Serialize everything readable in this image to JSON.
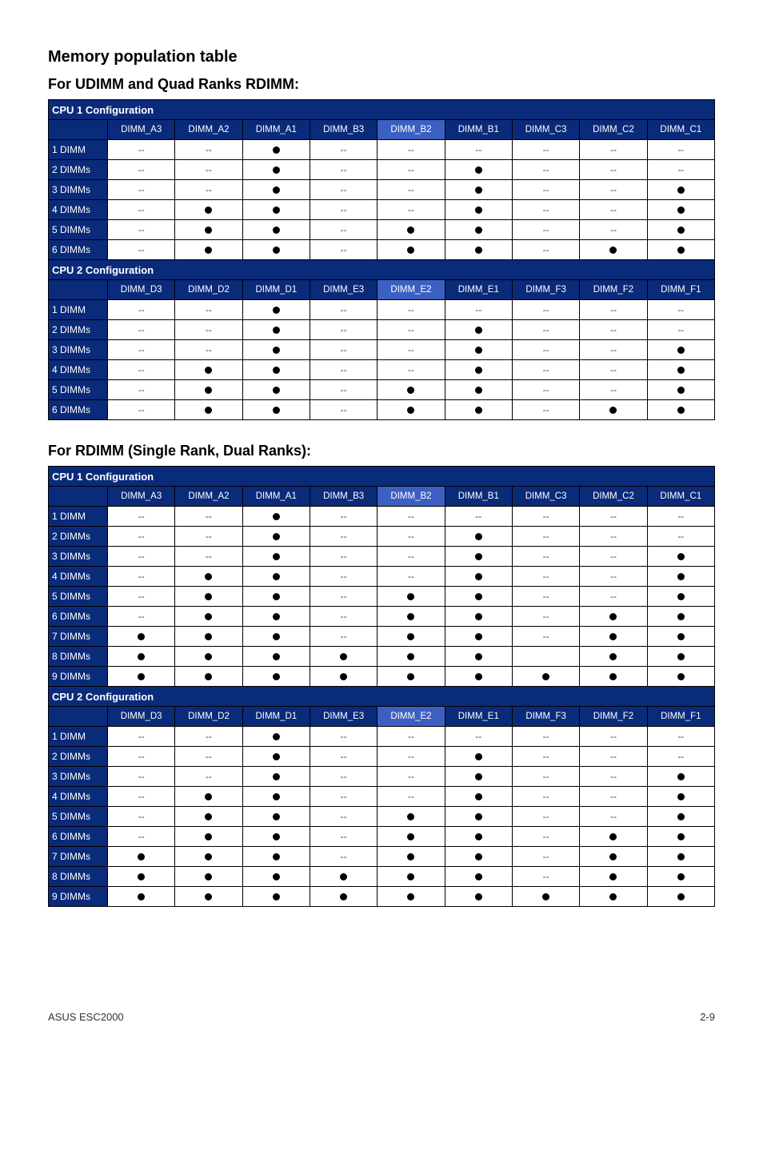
{
  "title": "Memory population table",
  "subtitle1": "For UDIMM and Quad Ranks RDIMM:",
  "subtitle2": "For RDIMM (Single Rank, Dual Ranks):",
  "footer_left": "ASUS ESC2000",
  "footer_right": "2-9",
  "cpu1_title": "CPU 1 Configuration",
  "cpu2_title": "CPU 2 Configuration",
  "cols_cpu1": [
    "DIMM_A3",
    "DIMM_A2",
    "DIMM_A1",
    "DIMM_B3",
    "DIMM_B2",
    "DIMM_B1",
    "DIMM_C3",
    "DIMM_C2",
    "DIMM_C1"
  ],
  "cols_cpu2": [
    "DIMM_D3",
    "DIMM_D2",
    "DIMM_D1",
    "DIMM_E3",
    "DIMM_E2",
    "DIMM_E1",
    "DIMM_F3",
    "DIMM_F2",
    "DIMM_F1"
  ],
  "table1": {
    "cpu1": [
      {
        "label": "1 DIMM",
        "cells": [
          "-",
          "-",
          "o",
          "-",
          "-",
          "-",
          "-",
          "-",
          "-"
        ]
      },
      {
        "label": "2 DIMMs",
        "cells": [
          "-",
          "-",
          "o",
          "-",
          "-",
          "o",
          "-",
          "-",
          "-"
        ]
      },
      {
        "label": "3 DIMMs",
        "cells": [
          "-",
          "-",
          "o",
          "-",
          "-",
          "o",
          "-",
          "-",
          "o"
        ]
      },
      {
        "label": "4 DIMMs",
        "cells": [
          "-",
          "o",
          "o",
          "-",
          "-",
          "o",
          "-",
          "-",
          "o"
        ]
      },
      {
        "label": "5 DIMMs",
        "cells": [
          "-",
          "o",
          "o",
          "-",
          "o",
          "o",
          "-",
          "-",
          "o"
        ]
      },
      {
        "label": "6 DIMMs",
        "cells": [
          "-",
          "o",
          "o",
          "-",
          "o",
          "o",
          "-",
          "o",
          "o"
        ]
      }
    ],
    "cpu2": [
      {
        "label": "1 DIMM",
        "cells": [
          "-",
          "-",
          "o",
          "-",
          "-",
          "-",
          "-",
          "-",
          "-"
        ]
      },
      {
        "label": "2 DIMMs",
        "cells": [
          "-",
          "-",
          "o",
          "-",
          "-",
          "o",
          "-",
          "-",
          "-"
        ]
      },
      {
        "label": "3 DIMMs",
        "cells": [
          "-",
          "-",
          "o",
          "-",
          "-",
          "o",
          "-",
          "-",
          "o"
        ]
      },
      {
        "label": "4 DIMMs",
        "cells": [
          "-",
          "o",
          "o",
          "-",
          "-",
          "o",
          "-",
          "-",
          "o"
        ]
      },
      {
        "label": "5 DIMMs",
        "cells": [
          "-",
          "o",
          "o",
          "-",
          "o",
          "o",
          "-",
          "-",
          "o"
        ]
      },
      {
        "label": "6 DIMMs",
        "cells": [
          "-",
          "o",
          "o",
          "-",
          "o",
          "o",
          "-",
          "o",
          "o"
        ]
      }
    ]
  },
  "table2": {
    "cpu1": [
      {
        "label": "1 DIMM",
        "cells": [
          "-",
          "-",
          "o",
          "-",
          "-",
          "-",
          "-",
          "-",
          "-"
        ]
      },
      {
        "label": "2 DIMMs",
        "cells": [
          "-",
          "-",
          "o",
          "-",
          "-",
          "o",
          "-",
          "-",
          "-"
        ]
      },
      {
        "label": "3 DIMMs",
        "cells": [
          "-",
          "-",
          "o",
          "-",
          "-",
          "o",
          "-",
          "-",
          "o"
        ]
      },
      {
        "label": "4 DIMMs",
        "cells": [
          "-",
          "o",
          "o",
          "-",
          "-",
          "o",
          "-",
          "-",
          "o"
        ]
      },
      {
        "label": "5 DIMMs",
        "cells": [
          "-",
          "o",
          "o",
          "-",
          "o",
          "o",
          "-",
          "-",
          "o"
        ]
      },
      {
        "label": "6 DIMMs",
        "cells": [
          "-",
          "o",
          "o",
          "-",
          "o",
          "o",
          "-",
          "o",
          "o"
        ]
      },
      {
        "label": "7 DIMMs",
        "cells": [
          "o",
          "o",
          "o",
          "-",
          "o",
          "o",
          "-",
          "o",
          "o"
        ]
      },
      {
        "label": "8 DIMMs",
        "cells": [
          "o",
          "o",
          "o",
          "o",
          "o",
          "o",
          "",
          "o",
          "o"
        ]
      },
      {
        "label": "9 DIMMs",
        "cells": [
          "o",
          "o",
          "o",
          "o",
          "o",
          "o",
          "o",
          "o",
          "o"
        ]
      }
    ],
    "cpu2": [
      {
        "label": "1 DIMM",
        "cells": [
          "-",
          "-",
          "o",
          "-",
          "-",
          "-",
          "-",
          "-",
          "-"
        ]
      },
      {
        "label": "2 DIMMs",
        "cells": [
          "-",
          "-",
          "o",
          "-",
          "-",
          "o",
          "-",
          "-",
          "-"
        ]
      },
      {
        "label": "3 DIMMs",
        "cells": [
          "-",
          "-",
          "o",
          "-",
          "-",
          "o",
          "-",
          "-",
          "o"
        ]
      },
      {
        "label": "4 DIMMs",
        "cells": [
          "-",
          "o",
          "o",
          "-",
          "-",
          "o",
          "-",
          "-",
          "o"
        ]
      },
      {
        "label": "5 DIMMs",
        "cells": [
          "-",
          "o",
          "o",
          "-",
          "o",
          "o",
          "-",
          "-",
          "o"
        ]
      },
      {
        "label": "6 DIMMs",
        "cells": [
          "-",
          "o",
          "o",
          "-",
          "o",
          "o",
          "-",
          "o",
          "o"
        ]
      },
      {
        "label": "7 DIMMs",
        "cells": [
          "o",
          "o",
          "o",
          "-",
          "o",
          "o",
          "-",
          "o",
          "o"
        ]
      },
      {
        "label": "8 DIMMs",
        "cells": [
          "o",
          "o",
          "o",
          "o",
          "o",
          "o",
          "-",
          "o",
          "o"
        ]
      },
      {
        "label": "9 DIMMs",
        "cells": [
          "o",
          "o",
          "o",
          "o",
          "o",
          "o",
          "o",
          "o",
          "o"
        ]
      }
    ]
  }
}
